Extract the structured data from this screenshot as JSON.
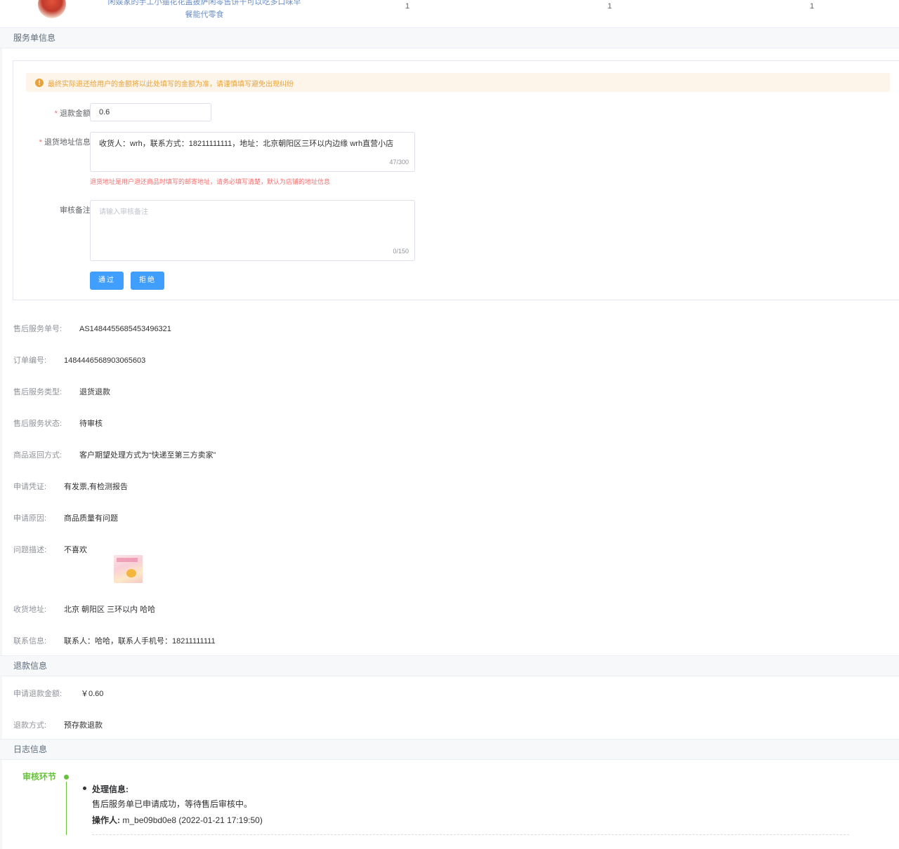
{
  "product": {
    "name": "闲娱家的手工小猫花花盖披萨闲零售饼干可以吃多口味早餐能代零食",
    "quantities": [
      "1",
      "1",
      "1"
    ]
  },
  "service_section": {
    "header": "服务单信息",
    "alert": "最终实际退还给用户的金额将以此处填写的金额为准，请谨慎填写避免出现纠纷",
    "refund_amount": {
      "label": "退款金额:",
      "value": "0.6"
    },
    "return_address": {
      "label": "退货地址信息:",
      "value": "收货人：wrh，联系方式：18211111111，地址：北京朝阳区三环以内边缘 wrh直营小店",
      "counter": "47/300",
      "tip": "退货地址是用户退还商品时填写的邮寄地址，请务必填写清楚，默认为店铺的地址信息"
    },
    "review_note": {
      "label": "审核备注:",
      "placeholder": "请输入审核备注",
      "counter": "0/150"
    },
    "approve_label": "通过",
    "reject_label": "拒绝"
  },
  "details": [
    {
      "label": "售后服务单号:",
      "value": "AS1484455685453496321"
    },
    {
      "label": "订单编号:",
      "value": "1484446568903065603"
    },
    {
      "label": "售后服务类型:",
      "value": "退货退款"
    },
    {
      "label": "售后服务状态:",
      "value": "待审核"
    },
    {
      "label": "商品返回方式:",
      "value": "客户期望处理方式为“快递至第三方卖家”"
    },
    {
      "label": "申请凭证:",
      "value": "有发票,有检测报告"
    },
    {
      "label": "申请原因:",
      "value": "商品质量有问题"
    },
    {
      "label": "问题描述:",
      "value": "不喜欢"
    },
    {
      "label": "收货地址:",
      "value": "北京 朝阳区 三环以内 哈哈"
    },
    {
      "label": "联系信息:",
      "value": "联系人：哈哈，联系人手机号：18211111111"
    }
  ],
  "refund_section": {
    "header": "退款信息",
    "items": [
      {
        "label": "申请退款金额:",
        "value": "￥0.60"
      },
      {
        "label": "退款方式:",
        "value": "预存款退款"
      }
    ]
  },
  "log_section": {
    "header": "日志信息",
    "stage": "审核环节",
    "entry_title": "处理信息:",
    "entry_message": "售后服务单已申请成功，等待售后审核中。",
    "operator_label": "操作人:",
    "operator_value": "m_be09bd0e8 (2022-01-21 17:19:50)"
  },
  "colors": {
    "primary": "#409eff",
    "success": "#67c23a",
    "warning": "#e6a23c",
    "danger": "#f56c6c"
  }
}
